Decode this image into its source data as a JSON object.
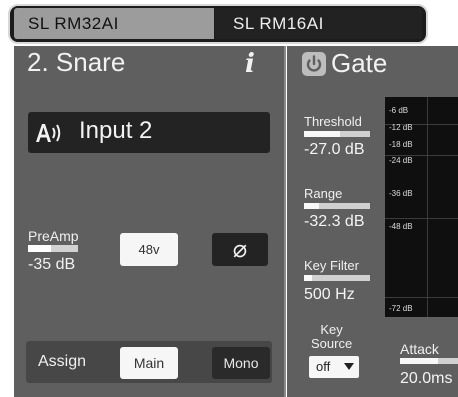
{
  "tabs": [
    {
      "label": "SL RM32AI",
      "selected": true
    },
    {
      "label": "SL RM16AI",
      "selected": false
    }
  ],
  "channel": {
    "title": "2. Snare",
    "info_icon": "info-icon",
    "input_name": "Input 2",
    "input_icon": "speaker-icon"
  },
  "preamp": {
    "label": "PreAmp",
    "value": "-35 dB",
    "level_fraction": 0.45,
    "phantom_label": "48v",
    "phase_symbol": "⌀"
  },
  "assign": {
    "label": "Assign",
    "main_label": "Main",
    "mono_label": "Mono"
  },
  "gate": {
    "title": "Gate",
    "power_icon": "power-icon",
    "threshold": {
      "label": "Threshold",
      "value": "-27.0 dB",
      "level_fraction": 0.55
    },
    "range": {
      "label": "Range",
      "value": "-32.3 dB",
      "level_fraction": 0.22
    },
    "key_filter": {
      "label": "Key Filter",
      "value": "500 Hz",
      "level_fraction": 0.12
    },
    "key_source": {
      "label_line1": "Key",
      "label_line2": "Source",
      "value": "off"
    },
    "attack": {
      "label": "Attack",
      "value": "20.0ms",
      "level_fraction": 0.65
    },
    "meter_scale": [
      "-6 dB",
      "-12 dB",
      "-18 dB",
      "-24 dB",
      "-36 dB",
      "-48 dB",
      "-72 dB"
    ]
  },
  "colors": {
    "panel": "#5f5f5f",
    "dark": "#232323",
    "button_light": "#f6f6f6",
    "tab_selected": "#9c9c9c"
  }
}
